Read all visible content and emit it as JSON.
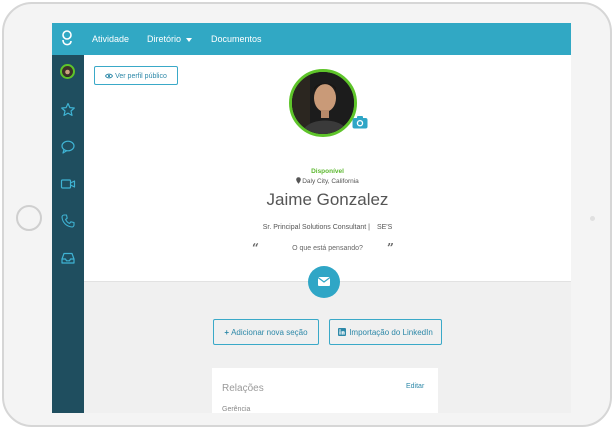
{
  "topbar": {
    "nav": [
      {
        "label": "Atividade"
      },
      {
        "label": "Diretório"
      },
      {
        "label": "Documentos"
      }
    ]
  },
  "sidebar": {
    "icons": [
      "avatar",
      "star-icon",
      "chat-icon",
      "video-icon",
      "phone-icon",
      "inbox-icon"
    ]
  },
  "profile": {
    "public_button": "Ver perfil público",
    "status": "Disponível",
    "location": "Daly City, California",
    "name": "Jaime Gonzalez",
    "job_title": "Sr. Principal Solutions Consultant |",
    "company": "SE'S",
    "thought_placeholder": "O que está pensando?"
  },
  "actions": {
    "add_section": "Adicionar nova seção",
    "linkedin_import": "Importação do LinkedIn"
  },
  "relations": {
    "title": "Relações",
    "edit": "Editar",
    "first_row": "Gerência"
  },
  "colors": {
    "topbar": "#31a8c4",
    "sidebar": "#1f4e5f",
    "accent": "#2fa6c6",
    "status_green": "#5cb82f"
  }
}
